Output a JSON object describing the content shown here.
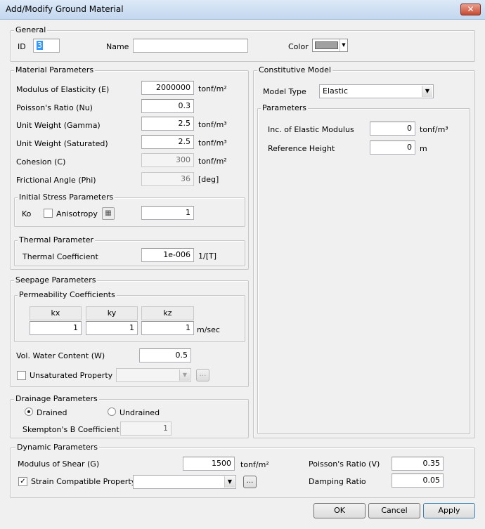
{
  "window": {
    "title": "Add/Modify Ground Material",
    "close": "✕"
  },
  "general": {
    "legend": "General",
    "id_label": "ID",
    "id_value": "3",
    "name_label": "Name",
    "name_value": "",
    "color_label": "Color",
    "color_value": "#a0a0a0"
  },
  "material": {
    "legend": "Material Parameters",
    "modulus_label": "Modulus of Elasticity (E)",
    "modulus_value": "2000000",
    "modulus_unit": "tonf/m²",
    "poisson_label": "Poisson's Ratio (Nu)",
    "poisson_value": "0.3",
    "unitweight_label": "Unit Weight (Gamma)",
    "unitweight_value": "2.5",
    "unitweight_unit": "tonf/m³",
    "satweight_label": "Unit Weight (Saturated)",
    "satweight_value": "2.5",
    "satweight_unit": "tonf/m³",
    "cohesion_label": "Cohesion (C)",
    "cohesion_value": "300",
    "cohesion_unit": "tonf/m²",
    "friction_label": "Frictional Angle (Phi)",
    "friction_value": "36",
    "friction_unit": "[deg]"
  },
  "initial_stress": {
    "legend": "Initial Stress Parameters",
    "ko_label": "Ko",
    "anisotropy_label": "Anisotropy",
    "ko_value": "1"
  },
  "thermal": {
    "legend": "Thermal Parameter",
    "coef_label": "Thermal Coefficient",
    "coef_value": "1e-006",
    "coef_unit": "1/[T]"
  },
  "seepage": {
    "legend": "Seepage Parameters",
    "perm_legend": "Permeability Coefficients",
    "headers": [
      "kx",
      "ky",
      "kz"
    ],
    "values": [
      "1",
      "1",
      "1"
    ],
    "unit": "m/sec",
    "water_label": "Vol. Water Content (W)",
    "water_value": "0.5",
    "unsat_label": "Unsaturated Property",
    "unsat_value": "",
    "ellipsis": "..."
  },
  "drainage": {
    "legend": "Drainage Parameters",
    "drained_label": "Drained",
    "undrained_label": "Undrained",
    "skempton_label": "Skempton's B Coefficient",
    "skempton_value": "1"
  },
  "constitutive": {
    "legend": "Constitutive Model",
    "model_label": "Model Type",
    "model_value": "Elastic",
    "params_legend": "Parameters",
    "inc_label": "Inc. of Elastic Modulus",
    "inc_value": "0",
    "inc_unit": "tonf/m³",
    "ref_label": "Reference Height",
    "ref_value": "0",
    "ref_unit": "m"
  },
  "dynamic": {
    "legend": "Dynamic Parameters",
    "shear_label": "Modulus of Shear (G)",
    "shear_value": "1500",
    "shear_unit": "tonf/m²",
    "poisson_label": "Poisson's Ratio (V)",
    "poisson_value": "0.35",
    "strain_label": "Strain Compatible Property",
    "strain_value": "",
    "ellipsis": "...",
    "damping_label": "Damping Ratio",
    "damping_value": "0.05"
  },
  "buttons": {
    "ok": "OK",
    "cancel": "Cancel",
    "apply": "Apply"
  }
}
